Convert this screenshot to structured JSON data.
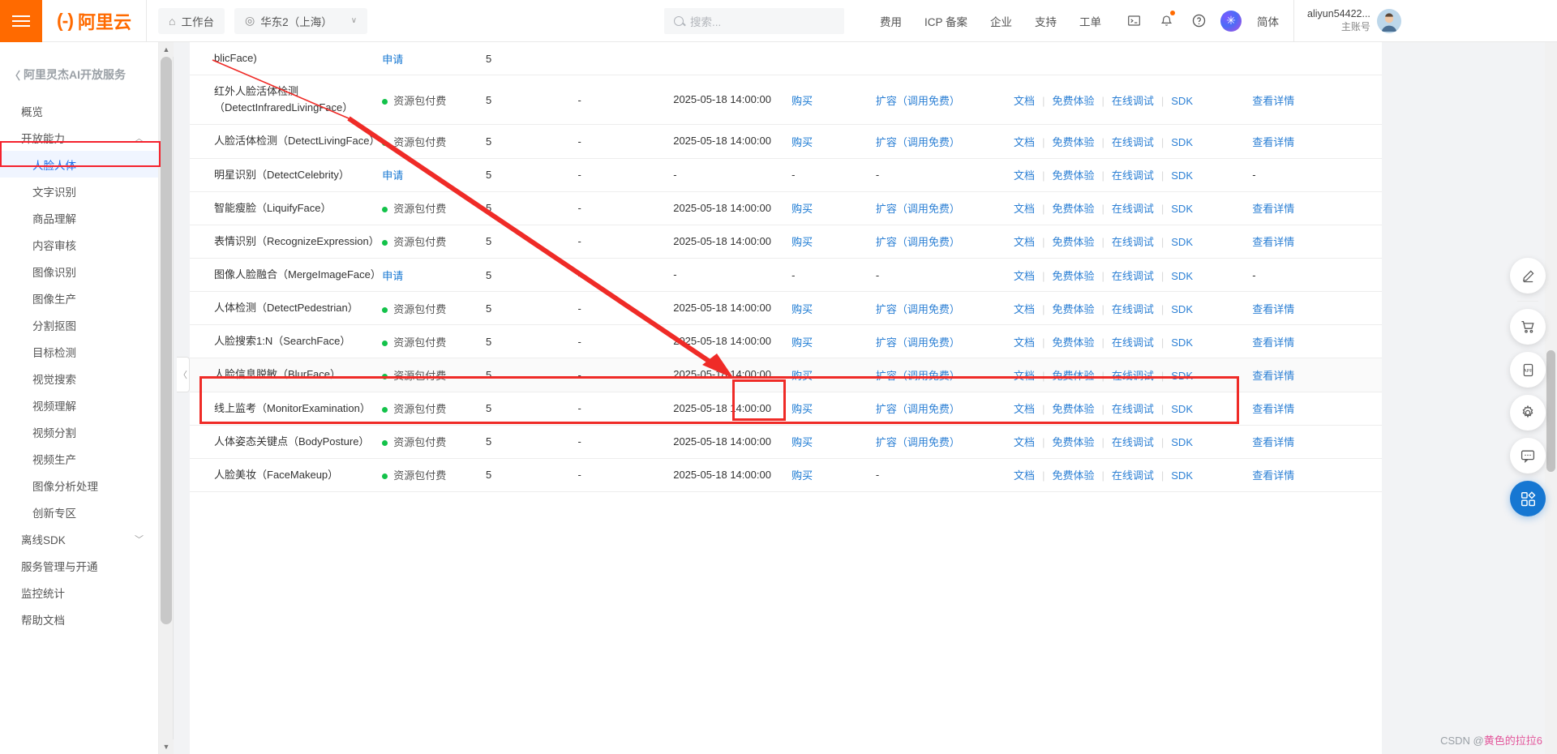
{
  "header": {
    "menu_icon": "hamburger-icon",
    "brand_mark": "(-)",
    "brand_text": "阿里云",
    "workbench": "工作台",
    "region": "华东2（上海）",
    "search_placeholder": "搜索...",
    "nav": [
      {
        "label": "费用"
      },
      {
        "label": "ICP 备案"
      },
      {
        "label": "企业"
      },
      {
        "label": "支持"
      },
      {
        "label": "工单"
      }
    ],
    "icons": [
      {
        "name": "terminal-icon"
      },
      {
        "name": "bell-icon"
      },
      {
        "name": "help-icon"
      },
      {
        "name": "ai-assistant-icon"
      }
    ],
    "lang": "简体",
    "user_name": "aliyun54422...",
    "user_role": "主账号"
  },
  "sidebar": {
    "title": "阿里灵杰AI开放服务",
    "items": [
      {
        "label": "概览",
        "level": 0,
        "active": false,
        "chevron": ""
      },
      {
        "label": "开放能力",
        "level": 0,
        "active": false,
        "chevron": "︿"
      },
      {
        "label": "人脸人体",
        "level": 1,
        "active": true,
        "chevron": ""
      },
      {
        "label": "文字识别",
        "level": 1,
        "active": false,
        "chevron": ""
      },
      {
        "label": "商品理解",
        "level": 1,
        "active": false,
        "chevron": ""
      },
      {
        "label": "内容审核",
        "level": 1,
        "active": false,
        "chevron": ""
      },
      {
        "label": "图像识别",
        "level": 1,
        "active": false,
        "chevron": ""
      },
      {
        "label": "图像生产",
        "level": 1,
        "active": false,
        "chevron": ""
      },
      {
        "label": "分割抠图",
        "level": 1,
        "active": false,
        "chevron": ""
      },
      {
        "label": "目标检测",
        "level": 1,
        "active": false,
        "chevron": ""
      },
      {
        "label": "视觉搜索",
        "level": 1,
        "active": false,
        "chevron": ""
      },
      {
        "label": "视频理解",
        "level": 1,
        "active": false,
        "chevron": ""
      },
      {
        "label": "视频分割",
        "level": 1,
        "active": false,
        "chevron": ""
      },
      {
        "label": "视频生产",
        "level": 1,
        "active": false,
        "chevron": ""
      },
      {
        "label": "图像分析处理",
        "level": 1,
        "active": false,
        "chevron": ""
      },
      {
        "label": "创新专区",
        "level": 1,
        "active": false,
        "chevron": ""
      },
      {
        "label": "离线SDK",
        "level": 0,
        "active": false,
        "chevron": "﹀"
      },
      {
        "label": "服务管理与开通",
        "level": 0,
        "active": false,
        "chevron": ""
      },
      {
        "label": "监控统计",
        "level": 0,
        "active": false,
        "chevron": ""
      },
      {
        "label": "帮助文档",
        "level": 0,
        "active": false,
        "chevron": ""
      }
    ]
  },
  "table": {
    "status_paid_label": "资源包付费",
    "apply_label": "申请",
    "buy_label": "购买",
    "expand_label": "扩容（调用免费）",
    "doc_label": "文档",
    "trial_label": "免费体验",
    "debug_label": "在线调试",
    "sdk_label": "SDK",
    "detail_label": "查看详情",
    "dash": "-",
    "rows": [
      {
        "name": "blicFace)",
        "partial": true,
        "status": "申请",
        "status_type": "apply",
        "quota": "5",
        "used": "",
        "date": "",
        "buy": "",
        "expand": "",
        "detail": ""
      },
      {
        "name": "红外人脸活体检测（DetectInfraredLivingFace）",
        "status": "资源包付费",
        "status_type": "paid",
        "quota": "5",
        "used": "-",
        "date": "2025-05-18 14:00:00",
        "buy": "购买",
        "expand": "扩容（调用免费）",
        "detail": "查看详情"
      },
      {
        "name": "人脸活体检测（DetectLivingFace）",
        "status": "资源包付费",
        "status_type": "paid",
        "quota": "5",
        "used": "-",
        "date": "2025-05-18 14:00:00",
        "buy": "购买",
        "expand": "扩容（调用免费）",
        "detail": "查看详情"
      },
      {
        "name": "明星识别（DetectCelebrity）",
        "status": "申请",
        "status_type": "apply",
        "quota": "5",
        "used": "-",
        "date": "-",
        "buy": "-",
        "expand": "-",
        "detail": "-"
      },
      {
        "name": "智能瘦脸（LiquifyFace）",
        "status": "资源包付费",
        "status_type": "paid",
        "quota": "5",
        "used": "-",
        "date": "2025-05-18 14:00:00",
        "buy": "购买",
        "expand": "扩容（调用免费）",
        "detail": "查看详情"
      },
      {
        "name": "表情识别（RecognizeExpression）",
        "status": "资源包付费",
        "status_type": "paid",
        "quota": "5",
        "used": "-",
        "date": "2025-05-18 14:00:00",
        "buy": "购买",
        "expand": "扩容（调用免费）",
        "detail": "查看详情"
      },
      {
        "name": "图像人脸融合（MergeImageFace）",
        "status": "申请",
        "status_type": "apply",
        "quota": "5",
        "used": "-",
        "date": "-",
        "buy": "-",
        "expand": "-",
        "detail": "-"
      },
      {
        "name": "人体检测（DetectPedestrian）",
        "status": "资源包付费",
        "status_type": "paid",
        "quota": "5",
        "used": "-",
        "date": "2025-05-18 14:00:00",
        "buy": "购买",
        "expand": "扩容（调用免费）",
        "detail": "查看详情"
      },
      {
        "name": "人脸搜索1:N（SearchFace）",
        "status": "资源包付费",
        "status_type": "paid",
        "quota": "5",
        "used": "-",
        "date": "2025-05-18 14:00:00",
        "buy": "购买",
        "expand": "扩容（调用免费）",
        "detail": "查看详情",
        "highlighted": true
      },
      {
        "name": "人脸信息脱敏（BlurFace）",
        "status": "资源包付费",
        "status_type": "paid",
        "quota": "5",
        "used": "-",
        "date": "2025-05-18 14:00:00",
        "buy": "购买",
        "expand": "扩容（调用免费）",
        "detail": "查看详情"
      },
      {
        "name": "线上监考（MonitorExamination）",
        "status": "资源包付费",
        "status_type": "paid",
        "quota": "5",
        "used": "-",
        "date": "2025-05-18 14:00:00",
        "buy": "购买",
        "expand": "扩容（调用免费）",
        "detail": "查看详情"
      },
      {
        "name": "人体姿态关键点（BodyPosture）",
        "status": "资源包付费",
        "status_type": "paid",
        "quota": "5",
        "used": "-",
        "date": "2025-05-18 14:00:00",
        "buy": "购买",
        "expand": "扩容（调用免费）",
        "detail": "查看详情"
      },
      {
        "name": "人脸美妆（FaceMakeup）",
        "status": "资源包付费",
        "status_type": "paid",
        "quota": "5",
        "used": "-",
        "date": "2025-05-18 14:00:00",
        "buy": "购买",
        "expand": "-",
        "detail": "查看详情"
      }
    ]
  },
  "dock": [
    {
      "name": "pencil-icon"
    },
    {
      "name": "cart-icon"
    },
    {
      "name": "app-icon"
    },
    {
      "name": "gear-icon"
    },
    {
      "name": "chat-icon"
    },
    {
      "name": "grid-icon"
    }
  ],
  "annotation": {
    "highlight_color": "#ef2b27",
    "sidebar_highlight": "人脸人体",
    "row_highlight": "人脸搜索1:N（SearchFace）",
    "button_highlight": "购买"
  },
  "watermark": {
    "prefix": "CSDN @",
    "name": "黄色的拉拉6"
  }
}
